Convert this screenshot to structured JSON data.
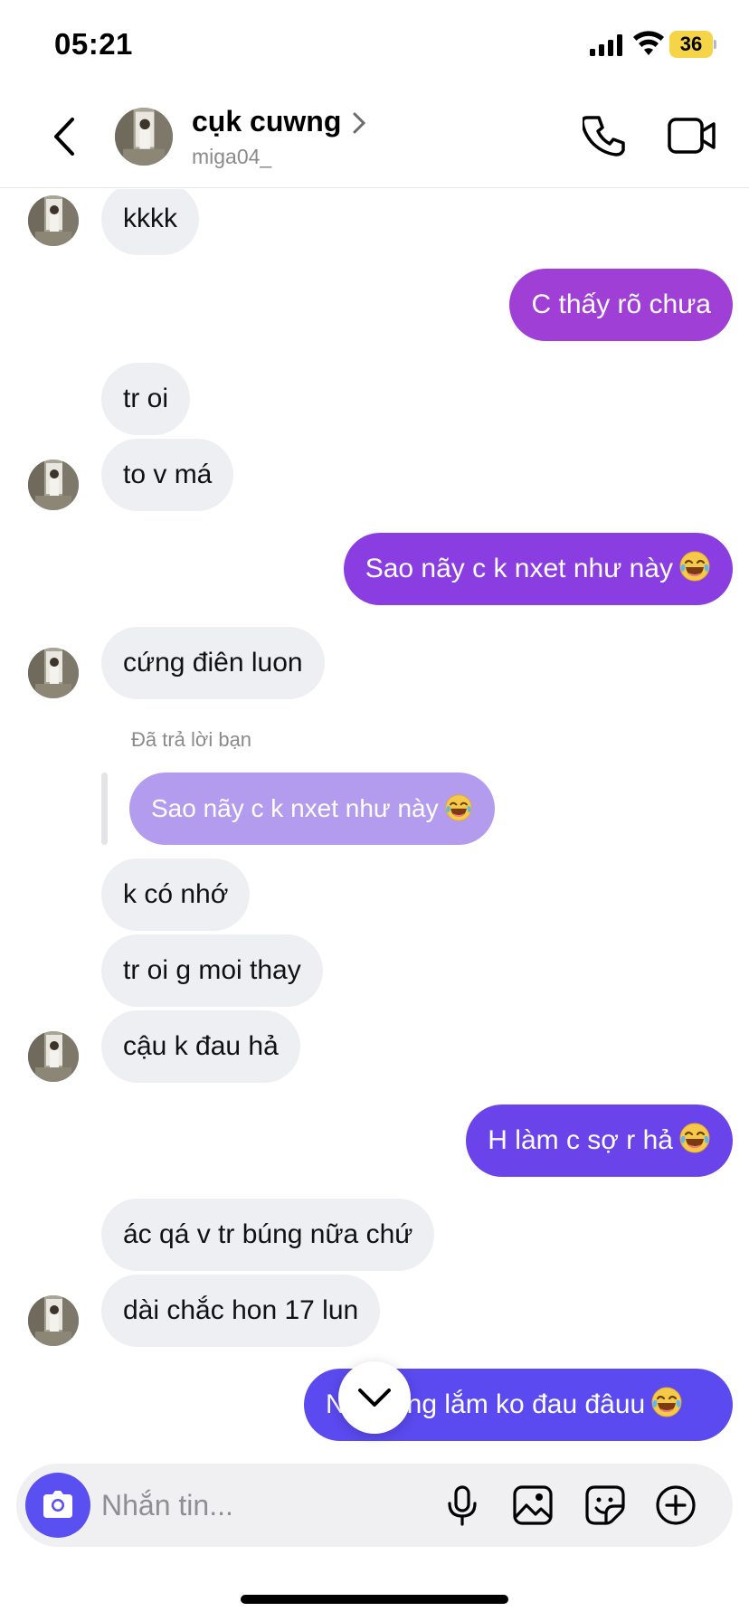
{
  "status_bar": {
    "time": "05:21",
    "battery": "36"
  },
  "header": {
    "name": "cụk cuwng",
    "handle": "miga04_"
  },
  "messages": [
    {
      "text": "kkkk"
    },
    {
      "text": "C thấy rõ chưa"
    },
    {
      "text": "tr oi"
    },
    {
      "text": "to v má"
    },
    {
      "text": "Sao nãy c k nxet như này"
    },
    {
      "text": "cứng điên luon"
    },
    {
      "text": "k có nhớ"
    },
    {
      "text": "tr oi g moi thay"
    },
    {
      "text": "cậu k đau hả"
    },
    {
      "text": "H làm c sợ r hả"
    },
    {
      "text": "ác qá v tr búng nữa chứ"
    },
    {
      "text": "dài chắc hon 17 lun"
    },
    {
      "text": "N",
      "text2": "ng lắm ko đau đâuu"
    }
  ],
  "reply": {
    "label": "Đã trả lời bạn",
    "quoted": "Sao nãy c k nxet như này"
  },
  "composer": {
    "placeholder": "Nhắn tin..."
  },
  "colors": {
    "outgoing_gradient": [
      "#b03ad1",
      "#5c47ef"
    ],
    "incoming": "#eeeff2",
    "quoted": "#b39cee",
    "accent": "#5a4ff0"
  },
  "icons": [
    "back-icon",
    "chevron-right-icon",
    "phone-icon",
    "video-icon",
    "chevron-down-icon",
    "camera-icon",
    "mic-icon",
    "gallery-icon",
    "sticker-icon",
    "plus-icon",
    "laugh-cry-emoji"
  ]
}
